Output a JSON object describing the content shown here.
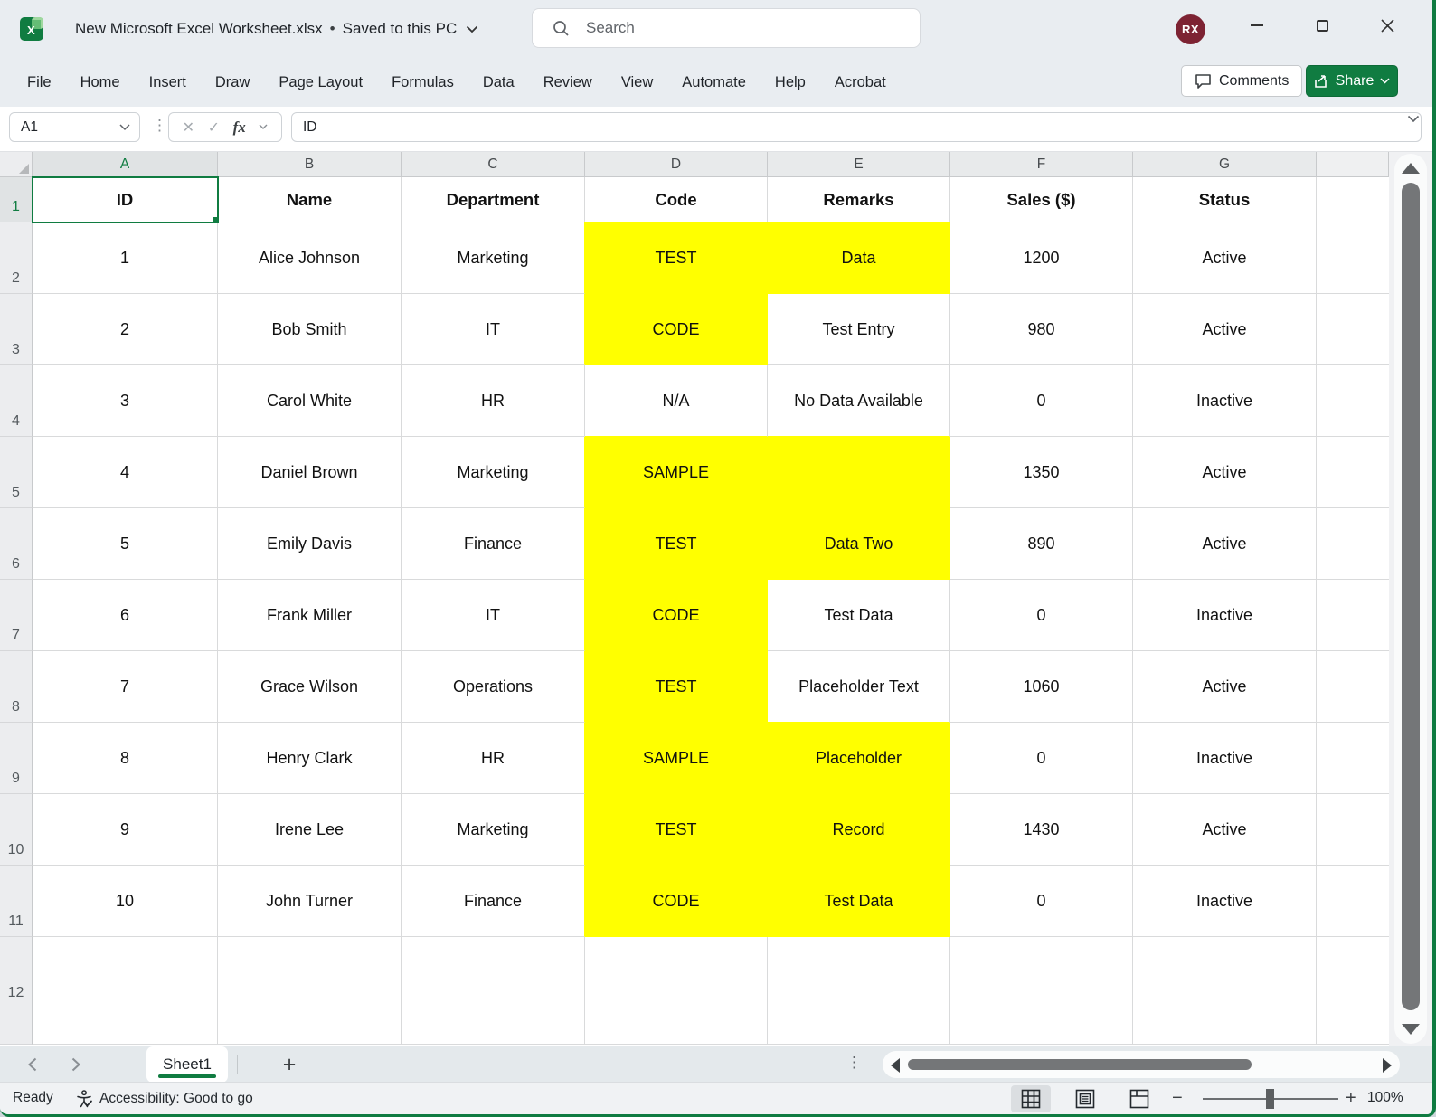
{
  "window": {
    "title": "New Microsoft Excel Worksheet.xlsx",
    "separator": "•",
    "save_status": "Saved to this PC",
    "search_placeholder": "Search",
    "avatar_initials": "RX"
  },
  "menu": {
    "items": [
      "File",
      "Home",
      "Insert",
      "Draw",
      "Page Layout",
      "Formulas",
      "Data",
      "Review",
      "View",
      "Automate",
      "Help",
      "Acrobat"
    ]
  },
  "actions": {
    "comments_label": "Comments",
    "share_label": "Share"
  },
  "formula_bar": {
    "name_box": "A1",
    "fx_label": "fx",
    "cancel_glyph": "✕",
    "enter_glyph": "✓",
    "dots_glyph": "⋮",
    "formula": "ID"
  },
  "grid": {
    "column_letters": [
      "A",
      "B",
      "C",
      "D",
      "E",
      "F",
      "G"
    ],
    "selected_cell": "A1",
    "first_row_number": "1",
    "header_row": [
      "ID",
      "Name",
      "Department",
      "Code",
      "Remarks",
      "Sales ($)",
      "Status"
    ],
    "rows": [
      {
        "n": "2",
        "cells": [
          "1",
          "Alice Johnson",
          "Marketing",
          "TEST",
          "Data",
          "1200",
          "Active"
        ],
        "hl": [
          3,
          4
        ]
      },
      {
        "n": "3",
        "cells": [
          "2",
          "Bob Smith",
          "IT",
          "CODE",
          "Test Entry",
          "980",
          "Active"
        ],
        "hl": [
          3
        ]
      },
      {
        "n": "4",
        "cells": [
          "3",
          "Carol White",
          "HR",
          "N/A",
          "No Data Available",
          "0",
          "Inactive"
        ],
        "hl": []
      },
      {
        "n": "5",
        "cells": [
          "4",
          "Daniel Brown",
          "Marketing",
          "SAMPLE",
          "",
          "1350",
          "Active"
        ],
        "hl": [
          3,
          4
        ]
      },
      {
        "n": "6",
        "cells": [
          "5",
          "Emily Davis",
          "Finance",
          "TEST",
          "Data Two",
          "890",
          "Active"
        ],
        "hl": [
          3,
          4
        ]
      },
      {
        "n": "7",
        "cells": [
          "6",
          "Frank Miller",
          "IT",
          "CODE",
          "Test Data",
          "0",
          "Inactive"
        ],
        "hl": [
          3
        ]
      },
      {
        "n": "8",
        "cells": [
          "7",
          "Grace Wilson",
          "Operations",
          "TEST",
          "Placeholder Text",
          "1060",
          "Active"
        ],
        "hl": [
          3
        ]
      },
      {
        "n": "9",
        "cells": [
          "8",
          "Henry Clark",
          "HR",
          "SAMPLE",
          "Placeholder",
          "0",
          "Inactive"
        ],
        "hl": [
          3,
          4
        ]
      },
      {
        "n": "10",
        "cells": [
          "9",
          "Irene Lee",
          "Marketing",
          "TEST",
          "Record",
          "1430",
          "Active"
        ],
        "hl": [
          3,
          4
        ]
      },
      {
        "n": "11",
        "cells": [
          "10",
          "John Turner",
          "Finance",
          "CODE",
          "Test Data",
          "0",
          "Inactive"
        ],
        "hl": [
          3,
          4
        ]
      }
    ],
    "empty_row_number": "12",
    "highlight_color": "#FFFF00"
  },
  "sheet_bar": {
    "active_tab": "Sheet1",
    "add_sheet_glyph": "+",
    "dots_glyph": "⋮"
  },
  "status_bar": {
    "mode": "Ready",
    "accessibility": "Accessibility: Good to go",
    "zoom_out_glyph": "−",
    "zoom_in_glyph": "+",
    "zoom_level": "100%"
  },
  "colors": {
    "accent_green": "#107C41",
    "highlight_yellow": "#FFFF00",
    "avatar_bg": "#7D2333"
  }
}
